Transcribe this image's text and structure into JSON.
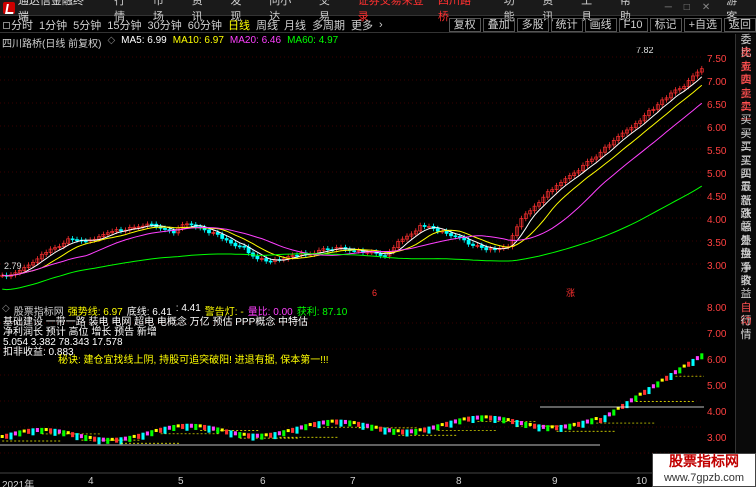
{
  "menubar": {
    "app_title": "通达信金融终端",
    "items": [
      "行情",
      "市场",
      "资讯",
      "发现",
      "问小达",
      "交易"
    ],
    "alert": "证券交易未登录",
    "stock_name": "四川路桥",
    "right_items": [
      "功能",
      "资讯",
      "工具",
      "帮助"
    ],
    "guest": "游客"
  },
  "toolbar": {
    "periods": [
      "分时",
      "1分钟",
      "5分钟",
      "15分钟",
      "30分钟",
      "60分钟",
      "日线",
      "周线",
      "月线",
      "多周期",
      "更多"
    ],
    "active_period": "日线",
    "right_buttons": [
      "复权",
      "叠加",
      "多股",
      "统计",
      "画线",
      "F10",
      "标记",
      "+自选",
      "返回"
    ]
  },
  "main": {
    "title": "四川路桥(日线 前复权)",
    "ma5": "MA5: 6.99",
    "ma10": "MA10: 6.97",
    "ma20": "MA20: 6.46",
    "ma60": "MA60: 4.97",
    "high_label": "7.82",
    "low_label": "2.79",
    "price_axis": [
      "7.50",
      "7.00",
      "6.50",
      "6.00",
      "5.50",
      "5.00",
      "4.50",
      "4.00",
      "3.50",
      "3.00"
    ],
    "marker_left": "6",
    "marker_right": "涨"
  },
  "sub": {
    "name": "股票指标网",
    "i1": "强势线: 6.97",
    "i2": "底线: 6.41",
    "i3": ": 4.41",
    "i4": "警告灯: -",
    "i5": "量比: 0.00",
    "i6": "获利: 87.10",
    "overlay_lines": [
      "基础建设 一带一路 装电 电网 超电 电概念 万亿 预估 PPP概念 中特估",
      "净利润长  预计 高位 增长 预告 新增",
      "5.054    3.382    78.343    17.578",
      "扣非收益: 0.883"
    ],
    "slogan": "秘诀: 建仓宜找线上阴, 持股可追突破阳! 进退有据, 保本第一!!!",
    "price_axis": [
      "8.00",
      "7.00",
      "6.00",
      "5.00",
      "4.00",
      "3.00"
    ]
  },
  "dates": [
    "2021年",
    "4",
    "5",
    "6",
    "7",
    "8",
    "9",
    "10",
    "11"
  ],
  "sidebar": [
    "委比",
    "卖五",
    "卖四",
    "卖三",
    "卖二",
    "卖一",
    "买一",
    "买二",
    "买三",
    "买四",
    "买五",
    "最新",
    "涨跌",
    "涨幅",
    "总量",
    "外盘",
    "换手",
    "净资",
    "收益",
    "",
    "自动",
    "行情"
  ],
  "watermark": {
    "line1": "股票指标网",
    "line2": "www.7gpzb.com"
  },
  "colors": {
    "up": "#ff3030",
    "down": "#00ffff",
    "ma5": "#ffffff",
    "ma10": "#ffff00",
    "ma20": "#ff40ff",
    "ma60": "#00ff00"
  }
}
